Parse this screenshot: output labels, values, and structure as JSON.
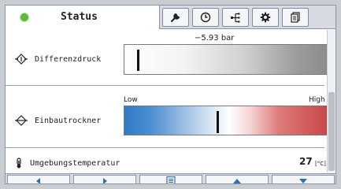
{
  "tabs": {
    "status_label": "Status",
    "status_indicator_color": "#5dbb3a",
    "icons": [
      "wrench-icon",
      "clock-icon",
      "network-icon",
      "gear-icon",
      "document-icon"
    ]
  },
  "rows": {
    "differential_pressure": {
      "label": "Differenzdruck",
      "value": "−5.93 bar"
    },
    "dryer": {
      "label": "Einbautrockner",
      "low_label": "Low",
      "high_label": "High"
    },
    "ambient": {
      "label": "Umgebungstemperatur",
      "value": "27",
      "unit": "[°C]"
    }
  },
  "navigation": {
    "icons": [
      "arrow-left-icon",
      "arrow-right-icon",
      "list-icon",
      "arrow-up-icon",
      "arrow-down-icon"
    ]
  },
  "colors": {
    "accent_blue": "#2f7bc7",
    "accent_red": "#c94747",
    "nav_arrow": "#2d6fb3"
  }
}
